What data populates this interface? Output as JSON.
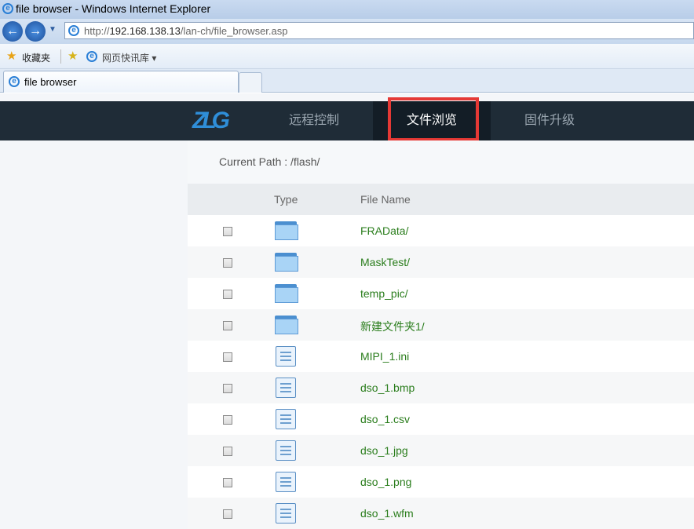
{
  "window": {
    "title": "file browser - Windows Internet Explorer"
  },
  "address": {
    "prefix": "http://",
    "host": "192.168.138.13",
    "path": "/lan-ch/file_browser.asp"
  },
  "favorites": {
    "label": "收藏夹",
    "feed": "网页快讯库"
  },
  "tabs": [
    {
      "label": "file browser"
    }
  ],
  "app": {
    "logo": "ZLG",
    "nav": [
      {
        "label": "远程控制"
      },
      {
        "label": "文件浏览"
      },
      {
        "label": "固件升级"
      }
    ],
    "current_path": "Current Path : /flash/",
    "columns": {
      "type": "Type",
      "name": "File Name"
    },
    "files": [
      {
        "name": "FRAData/",
        "type": "folder"
      },
      {
        "name": "MaskTest/",
        "type": "folder"
      },
      {
        "name": "temp_pic/",
        "type": "folder"
      },
      {
        "name": "新建文件夹1/",
        "type": "folder"
      },
      {
        "name": "MIPI_1.ini",
        "type": "file"
      },
      {
        "name": "dso_1.bmp",
        "type": "file"
      },
      {
        "name": "dso_1.csv",
        "type": "file"
      },
      {
        "name": "dso_1.jpg",
        "type": "file"
      },
      {
        "name": "dso_1.png",
        "type": "file"
      },
      {
        "name": "dso_1.wfm",
        "type": "file"
      }
    ]
  },
  "colors": {
    "highlight": "#e53935",
    "arrow": "#f0852d",
    "filename": "#2a7d1c"
  }
}
